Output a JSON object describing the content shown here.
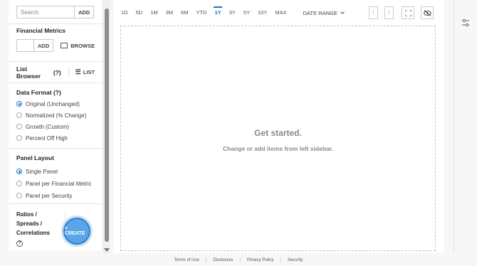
{
  "sidebar": {
    "search_placeholder": "Search",
    "search_add": "ADD",
    "financial_metrics": {
      "title": "Financial Metrics",
      "add": "ADD",
      "browse": "BROWSE"
    },
    "list_browser": {
      "title": "List Browser",
      "help": "(?)",
      "list": "LIST"
    },
    "data_format": {
      "title": "Data Format (?)",
      "options": [
        "Original (Unchanged)",
        "Normalized (% Change)",
        "Growth (Custom)",
        "Percent Off High"
      ],
      "selected": 0
    },
    "panel_layout": {
      "title": "Panel Layout",
      "options": [
        "Single Panel",
        "Panel per Financial Metric",
        "Panel per Security"
      ],
      "selected": 0
    },
    "ratios": {
      "line1": "Ratios /",
      "line2": "Spreads /",
      "line3": "Correlations",
      "help": "?",
      "create": "+ CREATE"
    }
  },
  "toolbar": {
    "ranges": [
      "1D",
      "5D",
      "1M",
      "3M",
      "6M",
      "YTD",
      "1Y",
      "3Y",
      "5Y",
      "10Y",
      "MAX"
    ],
    "active_range": "1Y",
    "date_range": "DATE RANGE",
    "icons": [
      "more-vertical-icon",
      "more-vertical-icon",
      "expand-icon",
      "hide-icon"
    ]
  },
  "empty_state": {
    "title": "Get started.",
    "subtitle": "Change or add items from left sidebar."
  },
  "footer": {
    "links": [
      "Terms of Use",
      "Disclosure",
      "Privacy Policy",
      "Security"
    ]
  },
  "colors": {
    "accent": "#1a73c8",
    "create_button": "#5aa5e8"
  }
}
